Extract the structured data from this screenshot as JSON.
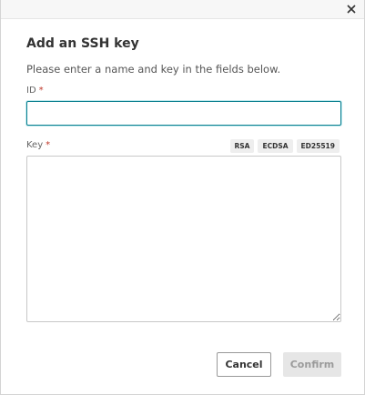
{
  "dialog": {
    "title": "Add an SSH key",
    "subtitle": "Please enter a name and key in the fields below.",
    "close_icon": "close-icon"
  },
  "fields": {
    "id": {
      "label": "ID",
      "required_mark": "*",
      "value": "",
      "placeholder": ""
    },
    "key": {
      "label": "Key",
      "required_mark": "*",
      "value": "",
      "placeholder": ""
    }
  },
  "key_types": [
    "RSA",
    "ECDSA",
    "ED25519"
  ],
  "buttons": {
    "cancel": "Cancel",
    "confirm": "Confirm"
  },
  "colors": {
    "accent": "#0a7f8f",
    "required": "#c0392b",
    "disabled_bg": "#e6e6e6",
    "disabled_text": "#9a9a9a"
  }
}
